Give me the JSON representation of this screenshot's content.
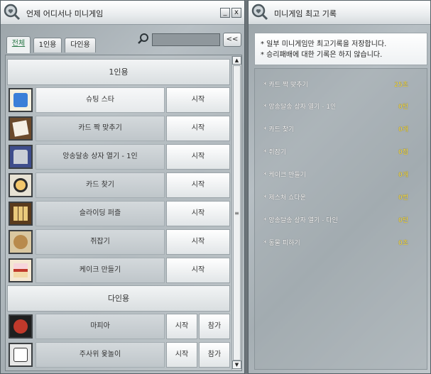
{
  "left": {
    "title": "언제 어디서나 미니게임",
    "tabs": [
      "전체",
      "1인용",
      "다인용"
    ],
    "scroll_btn": "<<",
    "sections": {
      "single": "1인용",
      "multi": "다인용"
    },
    "single_games": [
      {
        "name": "슈팅 스타",
        "start": "시작"
      },
      {
        "name": "카드 짝 맞추기",
        "start": "시작"
      },
      {
        "name": "앙송달송 상자 열기 - 1인",
        "start": "시작"
      },
      {
        "name": "카드 찾기",
        "start": "시작"
      },
      {
        "name": "슬라이딩 퍼즐",
        "start": "시작"
      },
      {
        "name": "쥐잡기",
        "start": "시작"
      },
      {
        "name": "케이크 만들기",
        "start": "시작"
      }
    ],
    "multi_games": [
      {
        "name": "마피아",
        "start": "시작",
        "join": "참가"
      },
      {
        "name": "주사위 윷놀이",
        "start": "시작",
        "join": "참가"
      }
    ]
  },
  "right": {
    "title": "미니게임 최고 기록",
    "notice": [
      "* 일부 미니게임만 최고기록을 저장합니다.",
      "* 승리패배에 대한 기록은 하지 않습니다."
    ],
    "records": [
      {
        "name": "* 카드 짝 맞추기",
        "value": "25초"
      },
      {
        "name": "* 앙송달송 상자 열기 - 1인",
        "value": "0턴"
      },
      {
        "name": "* 카드 찾기",
        "value": "0개"
      },
      {
        "name": "* 쥐잡기",
        "value": "0점"
      },
      {
        "name": "* 케이크 만들기",
        "value": "0개"
      },
      {
        "name": "* 제스처 쇼다운",
        "value": "0번"
      },
      {
        "name": "* 앙송달송 상자 열기 - 다인",
        "value": "0턴"
      },
      {
        "name": "* 동물 피하기",
        "value": "0초"
      }
    ]
  }
}
